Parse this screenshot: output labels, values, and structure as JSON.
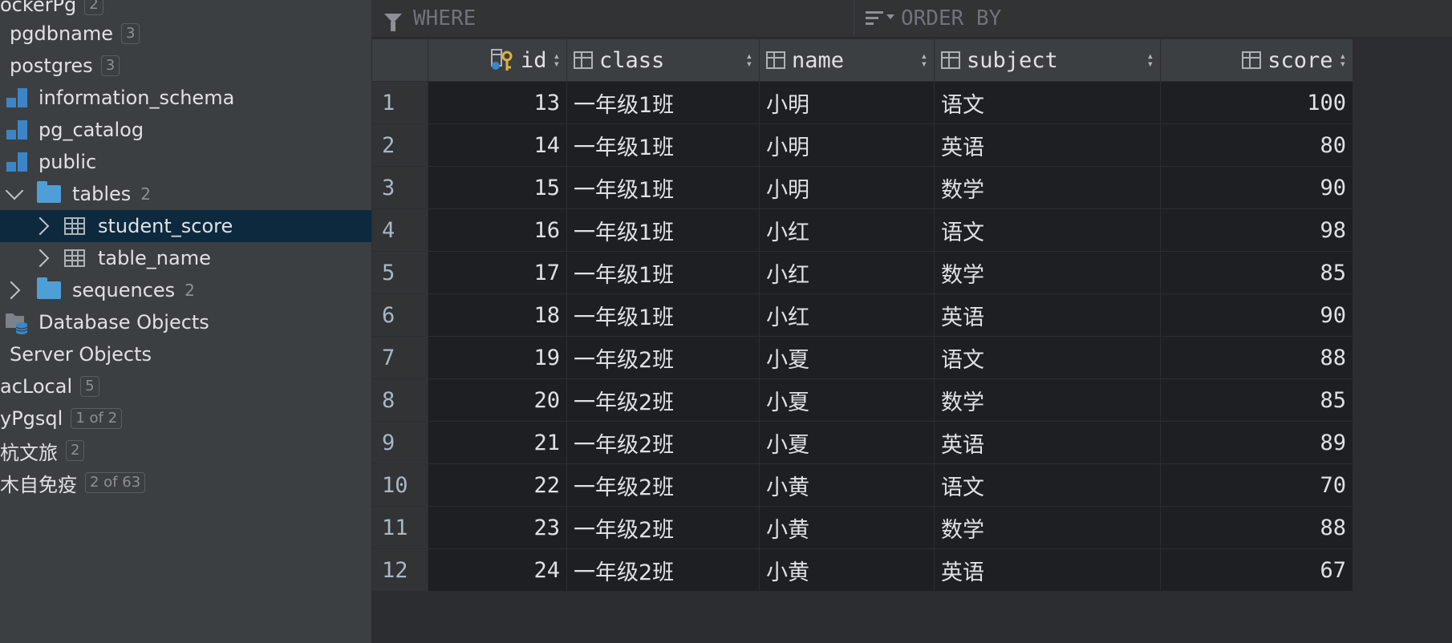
{
  "sidebar": {
    "items": [
      {
        "label": "ockerPg",
        "badge": "2"
      },
      {
        "label": "pgdbname",
        "badge": "3"
      },
      {
        "label": "postgres",
        "badge": "3"
      },
      {
        "label": "information_schema",
        "icon": "schema-icon"
      },
      {
        "label": "pg_catalog",
        "icon": "schema-icon"
      },
      {
        "label": "public",
        "icon": "schema-icon"
      },
      {
        "label": "tables",
        "badge": "2",
        "icon": "folder-icon"
      },
      {
        "label": "student_score",
        "icon": "table-icon",
        "selected": true
      },
      {
        "label": "table_name",
        "icon": "table-icon"
      },
      {
        "label": "sequences",
        "badge": "2",
        "icon": "folder-icon"
      },
      {
        "label": "Database Objects",
        "icon": "database-objects-icon"
      },
      {
        "label": "Server Objects"
      },
      {
        "label": "acLocal",
        "badge": "5"
      },
      {
        "label": "yPgsql",
        "badge": "1 of 2"
      },
      {
        "label": "杭文旅",
        "badge": "2"
      },
      {
        "label": "木自免疫",
        "badge": "2 of 63"
      }
    ]
  },
  "filter": {
    "where_label": "WHERE",
    "order_label": "ORDER BY"
  },
  "grid": {
    "columns": [
      "id",
      "class",
      "name",
      "subject",
      "score"
    ],
    "rows": [
      {
        "n": "1",
        "id": "13",
        "class": "一年级1班",
        "name": "小明",
        "subject": "语文",
        "score": "100"
      },
      {
        "n": "2",
        "id": "14",
        "class": "一年级1班",
        "name": "小明",
        "subject": "英语",
        "score": "80"
      },
      {
        "n": "3",
        "id": "15",
        "class": "一年级1班",
        "name": "小明",
        "subject": "数学",
        "score": "90"
      },
      {
        "n": "4",
        "id": "16",
        "class": "一年级1班",
        "name": "小红",
        "subject": "语文",
        "score": "98"
      },
      {
        "n": "5",
        "id": "17",
        "class": "一年级1班",
        "name": "小红",
        "subject": "数学",
        "score": "85"
      },
      {
        "n": "6",
        "id": "18",
        "class": "一年级1班",
        "name": "小红",
        "subject": "英语",
        "score": "90"
      },
      {
        "n": "7",
        "id": "19",
        "class": "一年级2班",
        "name": "小夏",
        "subject": "语文",
        "score": "88"
      },
      {
        "n": "8",
        "id": "20",
        "class": "一年级2班",
        "name": "小夏",
        "subject": "数学",
        "score": "85"
      },
      {
        "n": "9",
        "id": "21",
        "class": "一年级2班",
        "name": "小夏",
        "subject": "英语",
        "score": "89"
      },
      {
        "n": "10",
        "id": "22",
        "class": "一年级2班",
        "name": "小黄",
        "subject": "语文",
        "score": "70"
      },
      {
        "n": "11",
        "id": "23",
        "class": "一年级2班",
        "name": "小黄",
        "subject": "数学",
        "score": "88"
      },
      {
        "n": "12",
        "id": "24",
        "class": "一年级2班",
        "name": "小黄",
        "subject": "英语",
        "score": "67"
      }
    ]
  },
  "colors": {
    "sidebar_bg": "#3c3f41",
    "selected_bg": "#0d293e",
    "grid_bg": "#1e1f22",
    "header_bg": "#3c3f41",
    "accent_icon": "#3a86c8"
  }
}
